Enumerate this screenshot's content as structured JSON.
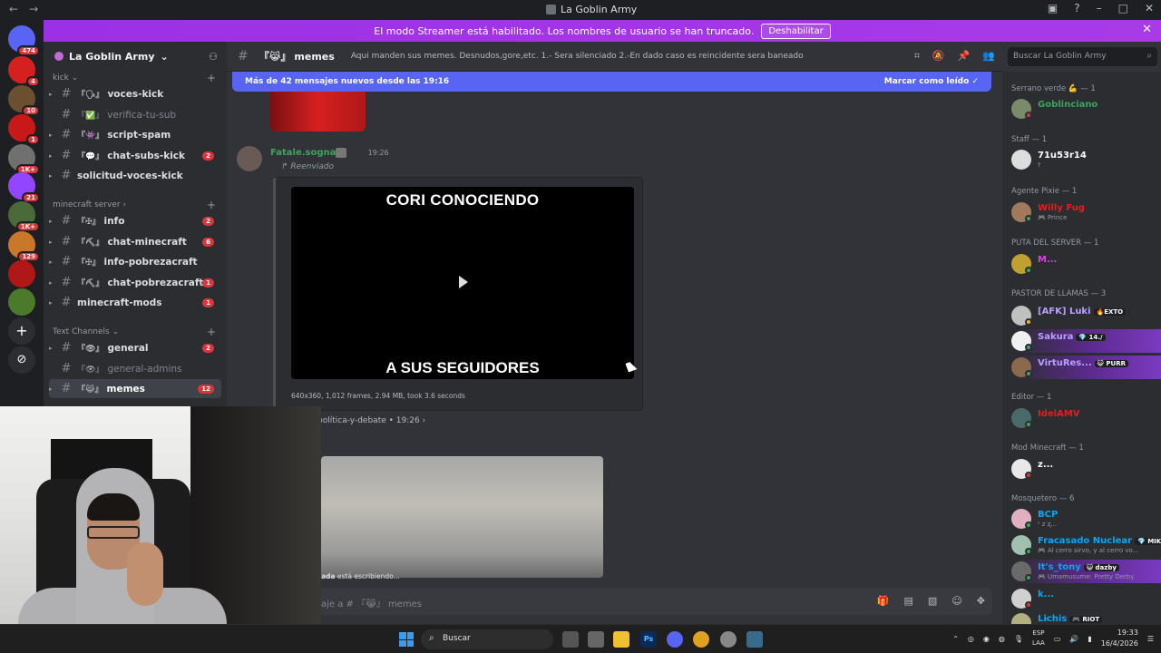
{
  "window": {
    "title": "La Goblin Army"
  },
  "banner": {
    "text": "El modo Streamer está habilitado. Los nombres de usuario se han truncado.",
    "button": "Deshabilitar"
  },
  "rail": {
    "badges": [
      "474",
      "4",
      "10",
      "1",
      "1K+",
      "21",
      "1K+",
      "129"
    ]
  },
  "sidebar": {
    "server_name": "La Goblin Army",
    "categories": [
      {
        "name": "kick"
      },
      {
        "name": "minecraft server"
      },
      {
        "name": "Text Channels"
      }
    ],
    "channels": [
      {
        "emoji": "『🗣』",
        "name": "voces-kick",
        "count": ""
      },
      {
        "emoji": "『✅』",
        "name": "verifica-tu-sub",
        "count": ""
      },
      {
        "emoji": "『👾』",
        "name": "script-spam",
        "count": ""
      },
      {
        "emoji": "『💬』",
        "name": "chat-subs-kick",
        "count": "2"
      },
      {
        "emoji": "",
        "name": "solicitud-voces-kick",
        "count": ""
      },
      {
        "emoji": "『✠』",
        "name": "info",
        "count": "2"
      },
      {
        "emoji": "『⛏』",
        "name": "chat-minecraft",
        "count": "6"
      },
      {
        "emoji": "『✠』",
        "name": "info-pobrezacraft",
        "count": ""
      },
      {
        "emoji": "『⛏』",
        "name": "chat-pobrezacraft",
        "count": "1"
      },
      {
        "emoji": "",
        "name": "minecraft-mods",
        "count": "1"
      },
      {
        "emoji": "『👁』",
        "name": "general",
        "count": "2"
      },
      {
        "emoji": "『👁』",
        "name": "general-admins",
        "count": ""
      },
      {
        "emoji": "『😹』",
        "name": "memes",
        "count": "12"
      }
    ]
  },
  "header": {
    "channel": "『😹』 memes",
    "topic": "Aqui manden sus memes. Desnudos,gore,etc. 1.- Sera silenciado 2.-En dado caso es reincidente sera baneado",
    "search_placeholder": "Buscar La Goblin Army"
  },
  "chat": {
    "new_messages": "Más de 42 mensajes nuevos desde las 19:16",
    "mark_read": "Marcar como leído",
    "author": "Fatale.sognare",
    "time": "19:26",
    "forwarded": "Reenviado",
    "video_top": "CORI CONOCIENDO",
    "video_bottom": "A SUS SEGUIDORES",
    "video_meta": "640x360, 1,012 frames, 2.94 MB, took 3.6 seconds",
    "thread": "política-y-debate  •  19:26  ›",
    "typing_name": "ada",
    "typing_text": " está escribiendo...",
    "input_placeholder": "aje a # 『😹』 memes"
  },
  "members": {
    "roles": [
      {
        "label": "Serrano verde 💪 — 1"
      },
      {
        "label": "Staff — 1"
      },
      {
        "label": "Agente Pixie — 1"
      },
      {
        "label": "PUTA DEL SERVER — 1"
      },
      {
        "label": "PASTOR DE LLAMAS — 3"
      },
      {
        "label": "Editor — 1"
      },
      {
        "label": "Mod Minecraft — 1"
      },
      {
        "label": "Mosquetero — 6"
      }
    ],
    "list": [
      {
        "name": "Goblinciano",
        "sub": "",
        "tag": "",
        "color": "#3ba55d"
      },
      {
        "name": "71u53r14",
        "sub": "†",
        "tag": "",
        "color": "#ffffff"
      },
      {
        "name": "Willy Fug",
        "sub": "🎮 Prince",
        "tag": "",
        "color": "#e02020"
      },
      {
        "name": "M...",
        "sub": "",
        "tag": "",
        "color": "#e040e0"
      },
      {
        "name": "[AFK] Luki",
        "sub": "",
        "tag": "🔥EXTO",
        "color": "#b9a0ff"
      },
      {
        "name": "Sakura",
        "sub": "",
        "tag": "💎 14./",
        "color": "#b9a0ff"
      },
      {
        "name": "VirtuRes...",
        "sub": "",
        "tag": "😺 PURR",
        "color": "#b9a0ff"
      },
      {
        "name": "IdelAMV",
        "sub": "",
        "tag": "",
        "color": "#e02020"
      },
      {
        "name": "z...",
        "sub": "",
        "tag": "",
        "color": "#ffffff"
      },
      {
        "name": "BCP",
        "sub": "ᶻ z ʐ...",
        "tag": "",
        "color": "#00a8fc"
      },
      {
        "name": "Fracasado Nuclear",
        "sub": "🎮 Al cerro sirvo, y al cerro vo...",
        "tag": "💎 MIKU",
        "color": "#00a8fc"
      },
      {
        "name": "It's_tony",
        "sub": "🎮 Umamusume: Pretty Derby",
        "tag": "😺 dazby",
        "color": "#00a8fc"
      },
      {
        "name": "k...",
        "sub": "",
        "tag": "",
        "color": "#00a8fc"
      },
      {
        "name": "Lichis",
        "sub": "",
        "tag": "🎮 RIOT",
        "color": "#00a8fc"
      }
    ]
  },
  "taskbar": {
    "search": "Buscar",
    "lang_top": "ESP",
    "lang_bottom": "LAA",
    "time": "19:33",
    "date": "16/4/2026"
  }
}
